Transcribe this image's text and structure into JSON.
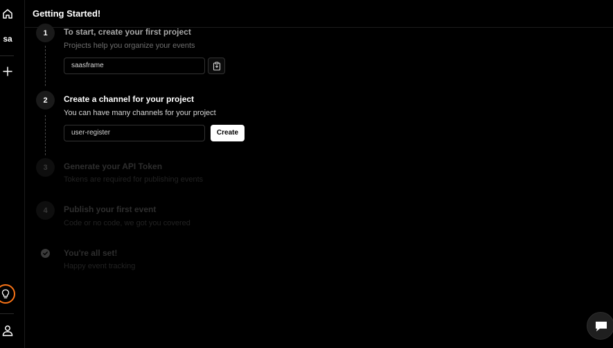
{
  "sidebar": {
    "home_icon": "home-icon",
    "workspace_initials": "sa",
    "add_icon": "plus-icon",
    "idea_icon": "lightbulb-icon",
    "user_icon": "user-icon"
  },
  "header": {
    "title": "Getting Started!"
  },
  "steps": [
    {
      "marker": "1",
      "title": "To start, create your first project",
      "subtitle": "Projects help you organize your events",
      "state": "done"
    },
    {
      "marker": "2",
      "title": "Create a channel for your project",
      "subtitle": "You can have many channels for your project",
      "state": "active"
    },
    {
      "marker": "3",
      "title": "Generate your API Token",
      "subtitle": "Tokens are required for publishing events",
      "state": "pending"
    },
    {
      "marker": "4",
      "title": "Publish your first event",
      "subtitle": "Code or no code, we got you covered",
      "state": "pending"
    },
    {
      "marker": "check-icon",
      "title": "You're all set!",
      "subtitle": "Happy event tracking",
      "state": "pending"
    }
  ],
  "project_field": {
    "value": "saasframe",
    "copy_icon": "clipboard-icon"
  },
  "channel_field": {
    "value": "user-register"
  },
  "create_button": {
    "label": "Create"
  },
  "chat_widget": {
    "icon": "chat-bubble-icon"
  },
  "colors": {
    "accent": "#f97316",
    "background": "#000000",
    "text": "#ffffff"
  }
}
